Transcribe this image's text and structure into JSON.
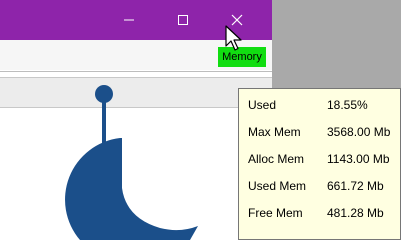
{
  "titlebar": {
    "color": "#8e24aa",
    "minimize_icon": "minimize-icon",
    "maximize_icon": "maximize-icon",
    "close_icon": "close-icon"
  },
  "toolbar": {
    "memory_label": "Memory",
    "memory_color": "#11dd11"
  },
  "memory_tooltip": {
    "rows": [
      {
        "label": "Used",
        "value": "18.55%"
      },
      {
        "label": "Max Mem",
        "value": "3568.00 Mb"
      },
      {
        "label": "Alloc Mem",
        "value": "1143.00 Mb"
      },
      {
        "label": "Used Mem",
        "value": "661.72 Mb"
      },
      {
        "label": "Free Mem",
        "value": "481.28 Mb"
      }
    ]
  },
  "logo": {
    "icon": "app-logo",
    "color": "#1b4f8a"
  }
}
